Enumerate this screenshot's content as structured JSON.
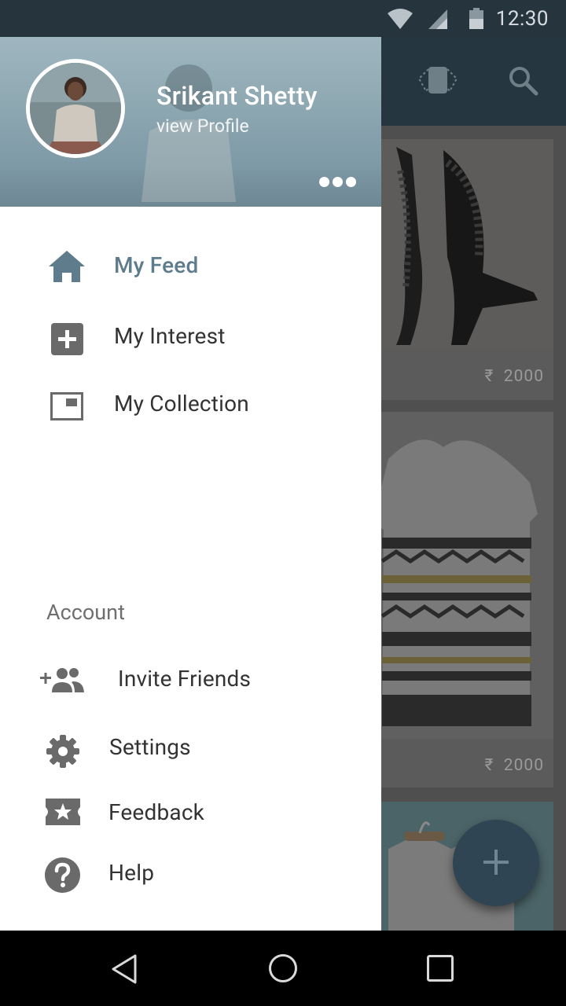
{
  "status_bar": {
    "time": "12:30"
  },
  "drawer": {
    "user": {
      "name": "Srikant Shetty",
      "subtitle": "view Profile"
    },
    "menu": [
      {
        "label": "My Feed",
        "icon": "home-icon",
        "active": true
      },
      {
        "label": "My Interest",
        "icon": "add-box-icon",
        "active": false
      },
      {
        "label": "My Collection",
        "icon": "collection-icon",
        "active": false
      }
    ],
    "account": {
      "section_label": "Account",
      "items": [
        {
          "label": "Invite Friends",
          "icon": "add-group-icon"
        },
        {
          "label": "Settings",
          "icon": "gear-icon"
        },
        {
          "label": "Feedback",
          "icon": "ticket-star-icon"
        },
        {
          "label": "Help",
          "icon": "help-icon"
        }
      ]
    }
  },
  "feed": {
    "items": [
      {
        "price": "2000",
        "currency": "₹"
      },
      {
        "price": "2000",
        "currency": "₹"
      }
    ]
  },
  "colors": {
    "active_accent": "#5e7c8c",
    "toolbar": "#263640",
    "status_bar": "#26343d"
  }
}
